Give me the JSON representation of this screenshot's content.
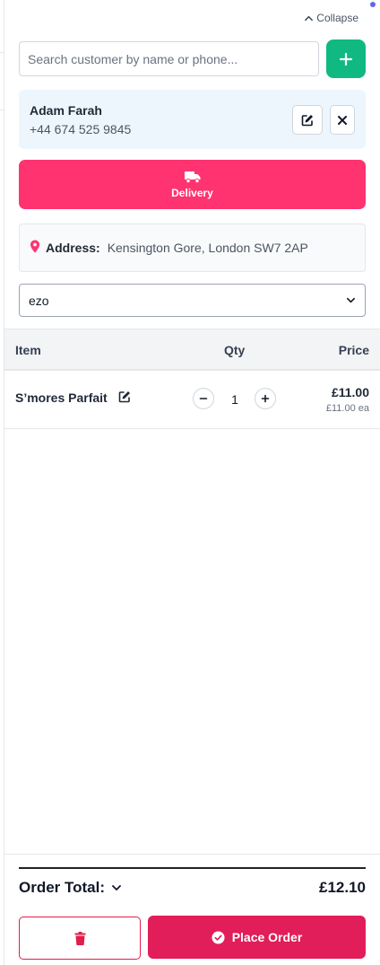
{
  "header": {
    "collapse_label": "Collapse"
  },
  "search": {
    "placeholder": "Search customer by name or phone..."
  },
  "customer": {
    "name": "Adam Farah",
    "phone": "+44 674 525 9845"
  },
  "delivery": {
    "label": "Delivery"
  },
  "address": {
    "label": "Address:",
    "value": "Kensington Gore, London SW7 2AP"
  },
  "select": {
    "value": "ezo"
  },
  "table": {
    "headers": {
      "item": "Item",
      "qty": "Qty",
      "price": "Price"
    },
    "rows": [
      {
        "name": "S’mores Parfait",
        "qty": "1",
        "price": "£11.00",
        "price_each": "£11.00 ea"
      }
    ]
  },
  "order": {
    "total_label": "Order Total:",
    "total_value": "£12.10",
    "place_label": "Place Order"
  },
  "colors": {
    "accent_pink": "#ff3370",
    "place_order": "#e11d5a",
    "add_green": "#10b981",
    "customer_card": "#eef6fd"
  }
}
